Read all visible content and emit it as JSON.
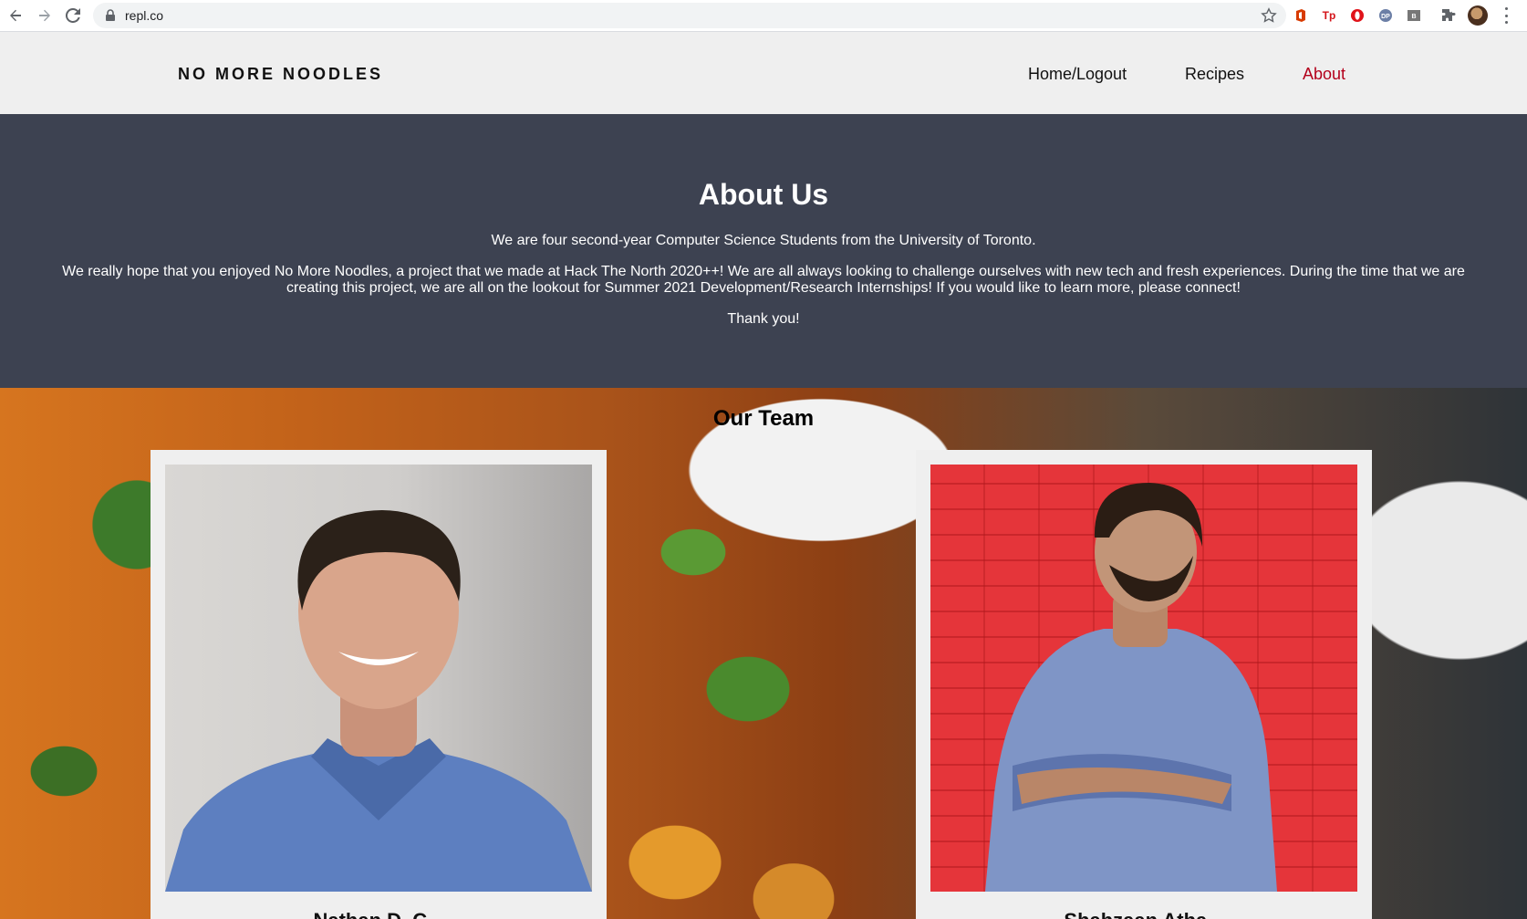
{
  "browser": {
    "url": "repl.co",
    "icons": [
      "back-icon",
      "forward-icon",
      "reload-icon",
      "lock-icon",
      "star-icon",
      "office-icon",
      "tp-icon",
      "opera-icon",
      "dp-icon",
      "bx-icon",
      "extensions-icon",
      "avatar",
      "kebab-menu-icon"
    ]
  },
  "header": {
    "brand": "NO MORE NOODLES",
    "nav": [
      {
        "label": "Home/Logout"
      },
      {
        "label": "Recipes"
      },
      {
        "label": "About",
        "active": true
      }
    ],
    "active_color": "#b3001b"
  },
  "about": {
    "title": "About Us",
    "p1": "We are four second-year Computer Science Students from the University of Toronto.",
    "p2": "We really hope that you enjoyed No More Noodles, a project that we made at Hack The North 2020++! We are all always looking to challenge ourselves with new tech and fresh experiences. During the time that we are creating this project, we are all on the lookout for Summer 2021 Development/Research Internships! If you would like to learn more, please connect!",
    "p3": "Thank you!",
    "background": "#3d4251"
  },
  "team": {
    "title": "Our Team",
    "members": [
      {
        "name": "Nathan D. C..."
      },
      {
        "name": "Shahzaan Atha..."
      }
    ]
  }
}
